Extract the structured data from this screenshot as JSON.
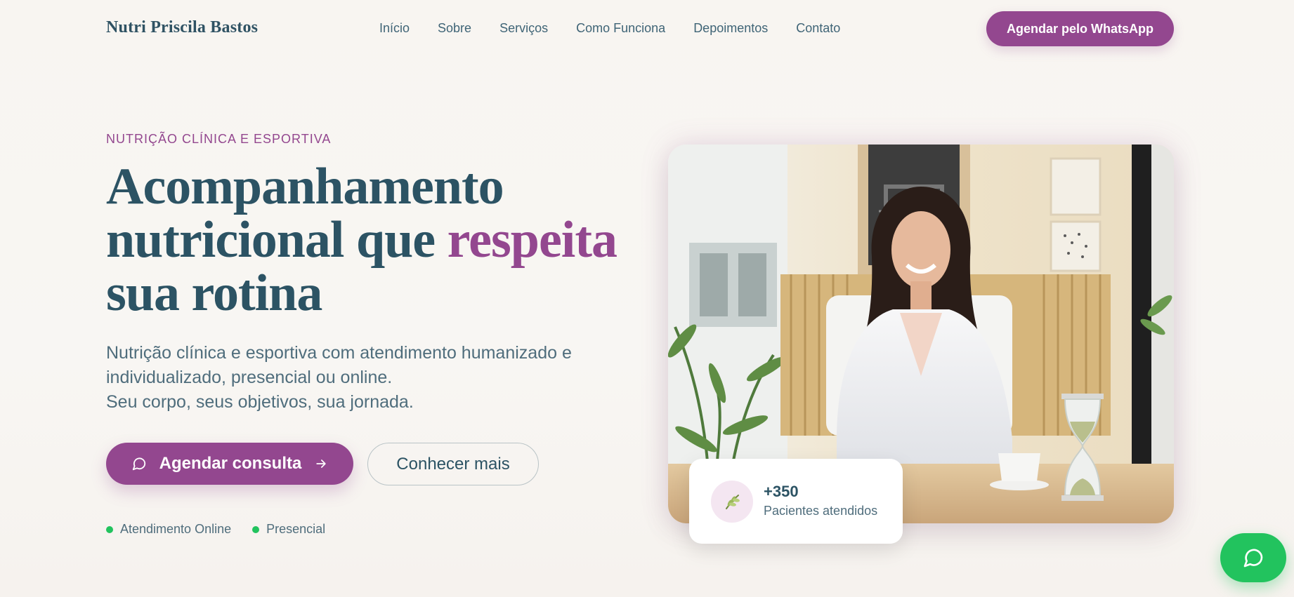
{
  "header": {
    "logo": "Nutri Priscila Bastos",
    "nav": [
      "Início",
      "Sobre",
      "Serviços",
      "Como Funciona",
      "Depoimentos",
      "Contato"
    ],
    "cta": "Agendar pelo WhatsApp"
  },
  "hero": {
    "eyebrow": "NUTRIÇÃO CLÍNICA E ESPORTIVA",
    "headline_part1": "Acompanhamento nutricional que ",
    "headline_accent": "respeita",
    "headline_part2": " sua rotina",
    "subtext_line1": "Nutrição clínica e esportiva com atendimento humanizado e individualizado, presencial ou online.",
    "subtext_line2": "Seu corpo, seus objetivos, sua jornada.",
    "primary_button": "Agendar consulta",
    "secondary_button": "Conhecer mais",
    "tags": [
      "Atendimento Online",
      "Presencial"
    ]
  },
  "stat": {
    "value": "+350",
    "label": "Pacientes atendidos",
    "icon": "leaf-icon"
  },
  "colors": {
    "brand": "#93478f",
    "text": "#2c5364",
    "whatsapp": "#22c35e",
    "background": "#f8f5f1"
  }
}
